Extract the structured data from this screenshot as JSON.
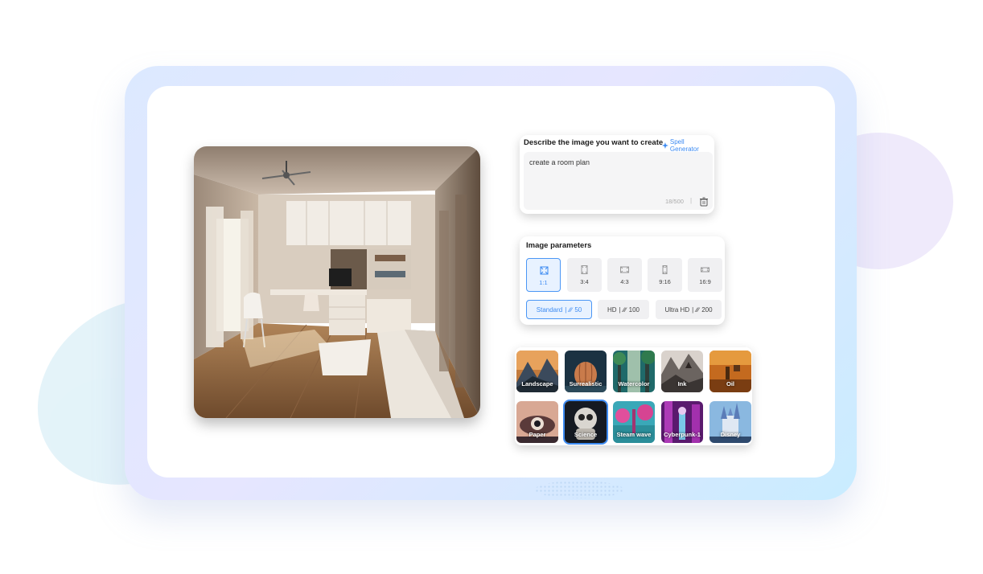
{
  "prompt": {
    "title": "Describe the image you want to create",
    "spell_generator": "Spell Generator",
    "text": "create a room plan",
    "counter": "18/500",
    "separator": "|"
  },
  "parameters": {
    "title": "Image parameters",
    "ratios": [
      {
        "label": "1:1",
        "selected": true
      },
      {
        "label": "3:4",
        "selected": false
      },
      {
        "label": "4:3",
        "selected": false
      },
      {
        "label": "9:16",
        "selected": false
      },
      {
        "label": "16:9",
        "selected": false
      }
    ],
    "qualities": [
      {
        "label": "Standard",
        "cost": "50",
        "selected": true
      },
      {
        "label": "HD",
        "cost": "100",
        "selected": false
      },
      {
        "label": "Ultra HD",
        "cost": "200",
        "selected": false
      }
    ]
  },
  "styles": [
    {
      "label": "Landscape",
      "selected": false
    },
    {
      "label": "Surrealistic",
      "selected": false
    },
    {
      "label": "Watercolor",
      "selected": false
    },
    {
      "label": "Ink",
      "selected": false
    },
    {
      "label": "Oil",
      "selected": false
    },
    {
      "label": "Paper",
      "selected": false
    },
    {
      "label": "Science",
      "selected": true
    },
    {
      "label": "Steam wave",
      "selected": false
    },
    {
      "label": "Cyberpunk-1",
      "selected": false
    },
    {
      "label": "Disney",
      "selected": false
    }
  ],
  "colors": {
    "accent": "#3d8bf2",
    "frame_start": "#dce9ff",
    "frame_end": "#c9ecff"
  }
}
